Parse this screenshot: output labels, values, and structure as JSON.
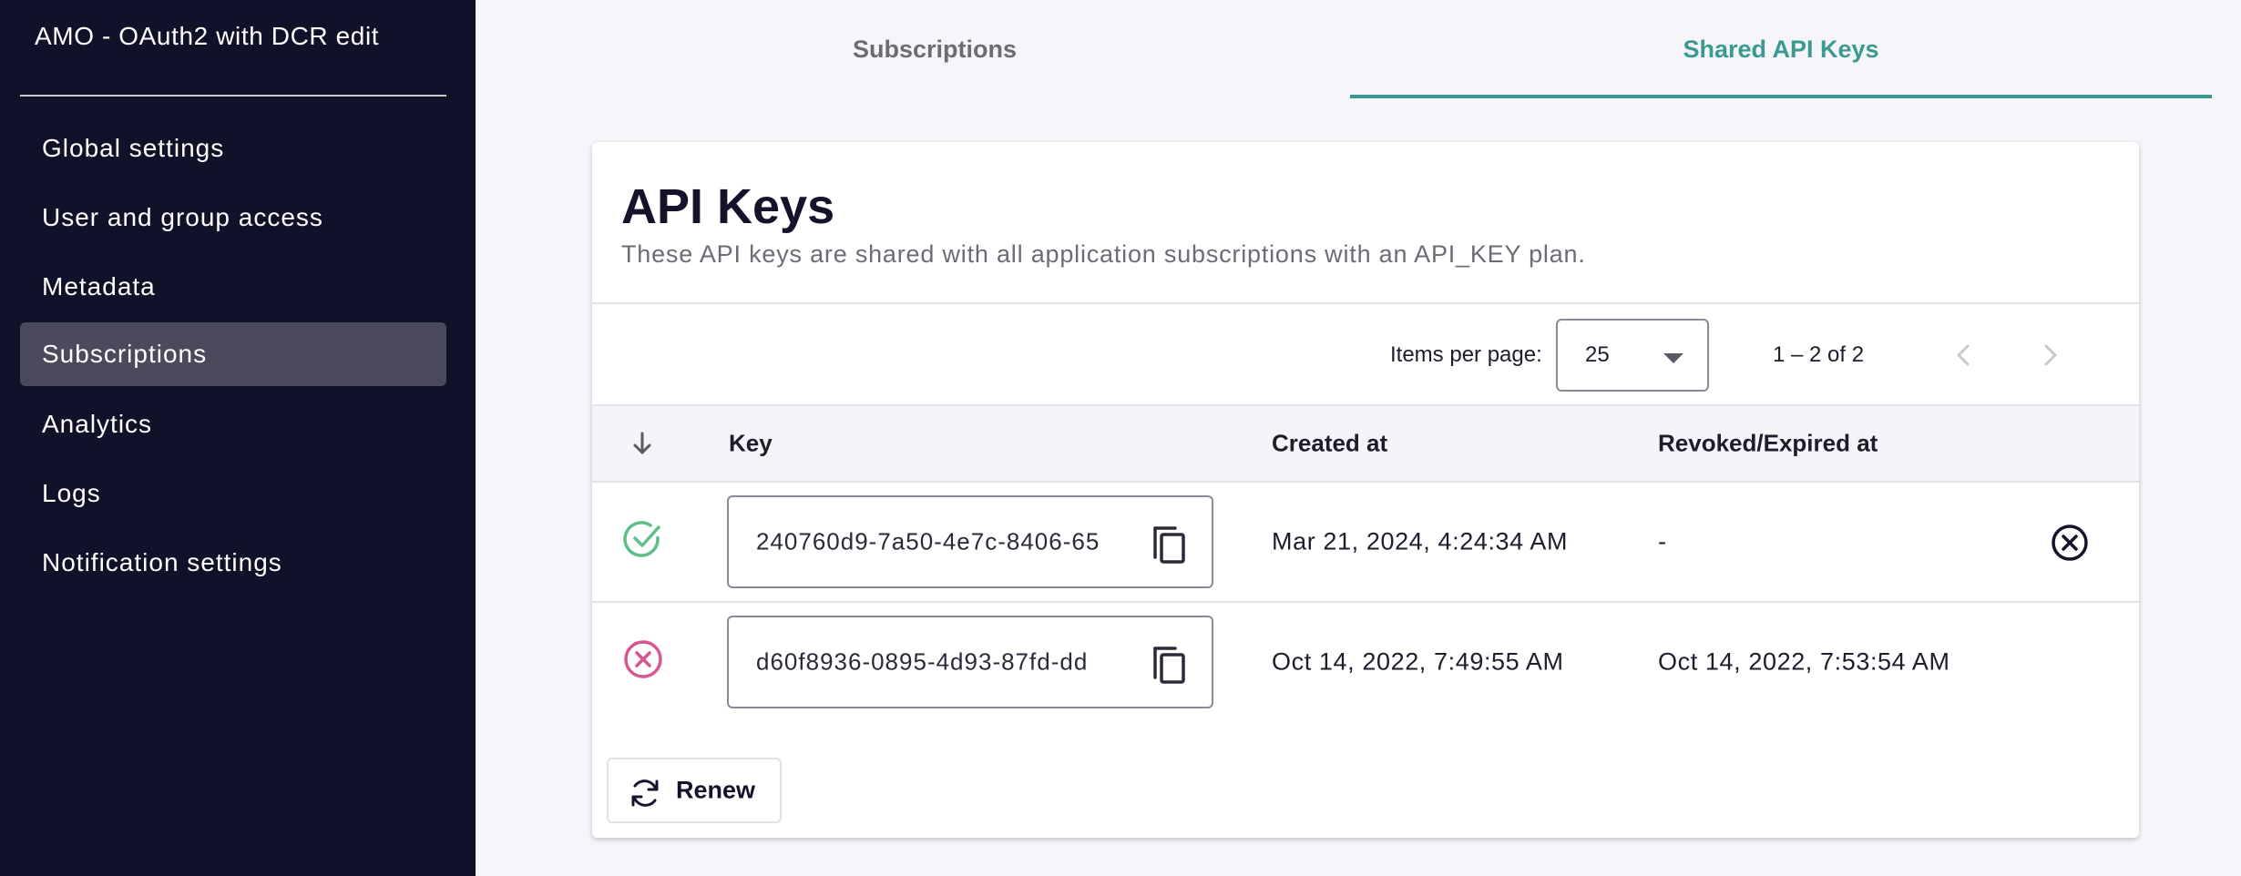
{
  "sidebar": {
    "title": "AMO - OAuth2 with DCR edit",
    "items": [
      {
        "label": "Global settings"
      },
      {
        "label": "User and group access"
      },
      {
        "label": "Metadata"
      },
      {
        "label": "Subscriptions",
        "active": true
      },
      {
        "label": "Analytics"
      },
      {
        "label": "Logs"
      },
      {
        "label": "Notification settings"
      }
    ]
  },
  "tabs": [
    {
      "label": "Subscriptions",
      "active": false
    },
    {
      "label": "Shared API Keys",
      "active": true
    }
  ],
  "card": {
    "title": "API Keys",
    "subtitle": "These API keys are shared with all application subscriptions with an API_KEY plan."
  },
  "paginator": {
    "items_per_page_label": "Items per page:",
    "items_per_page_value": "25",
    "range_label": "1 – 2 of 2"
  },
  "table": {
    "columns": [
      "Key",
      "Created at",
      "Revoked/Expired at"
    ],
    "rows": [
      {
        "status": "valid",
        "key": "240760d9-7a50-4e7c-8406-65",
        "created_at": "Mar 21, 2024, 4:24:34 AM",
        "revoked_at": "-"
      },
      {
        "status": "revoked",
        "key": "d60f8936-0895-4d93-87fd-dd",
        "created_at": "Oct 14, 2022, 7:49:55 AM",
        "revoked_at": "Oct 14, 2022, 7:53:54 AM"
      }
    ]
  },
  "actions": {
    "renew_label": "Renew"
  },
  "colors": {
    "sidebar_bg": "#12112a",
    "active_tab": "#3a9a92",
    "status_valid": "#5fbf8a",
    "status_revoked": "#d9558f"
  },
  "icons": {
    "sort": "arrow-down-icon",
    "valid": "check-circle-icon",
    "revoked": "x-circle-icon",
    "copy": "copy-icon",
    "revoke": "close-circle-icon",
    "renew": "refresh-icon",
    "prev": "chevron-left-icon",
    "next": "chevron-right-icon"
  }
}
